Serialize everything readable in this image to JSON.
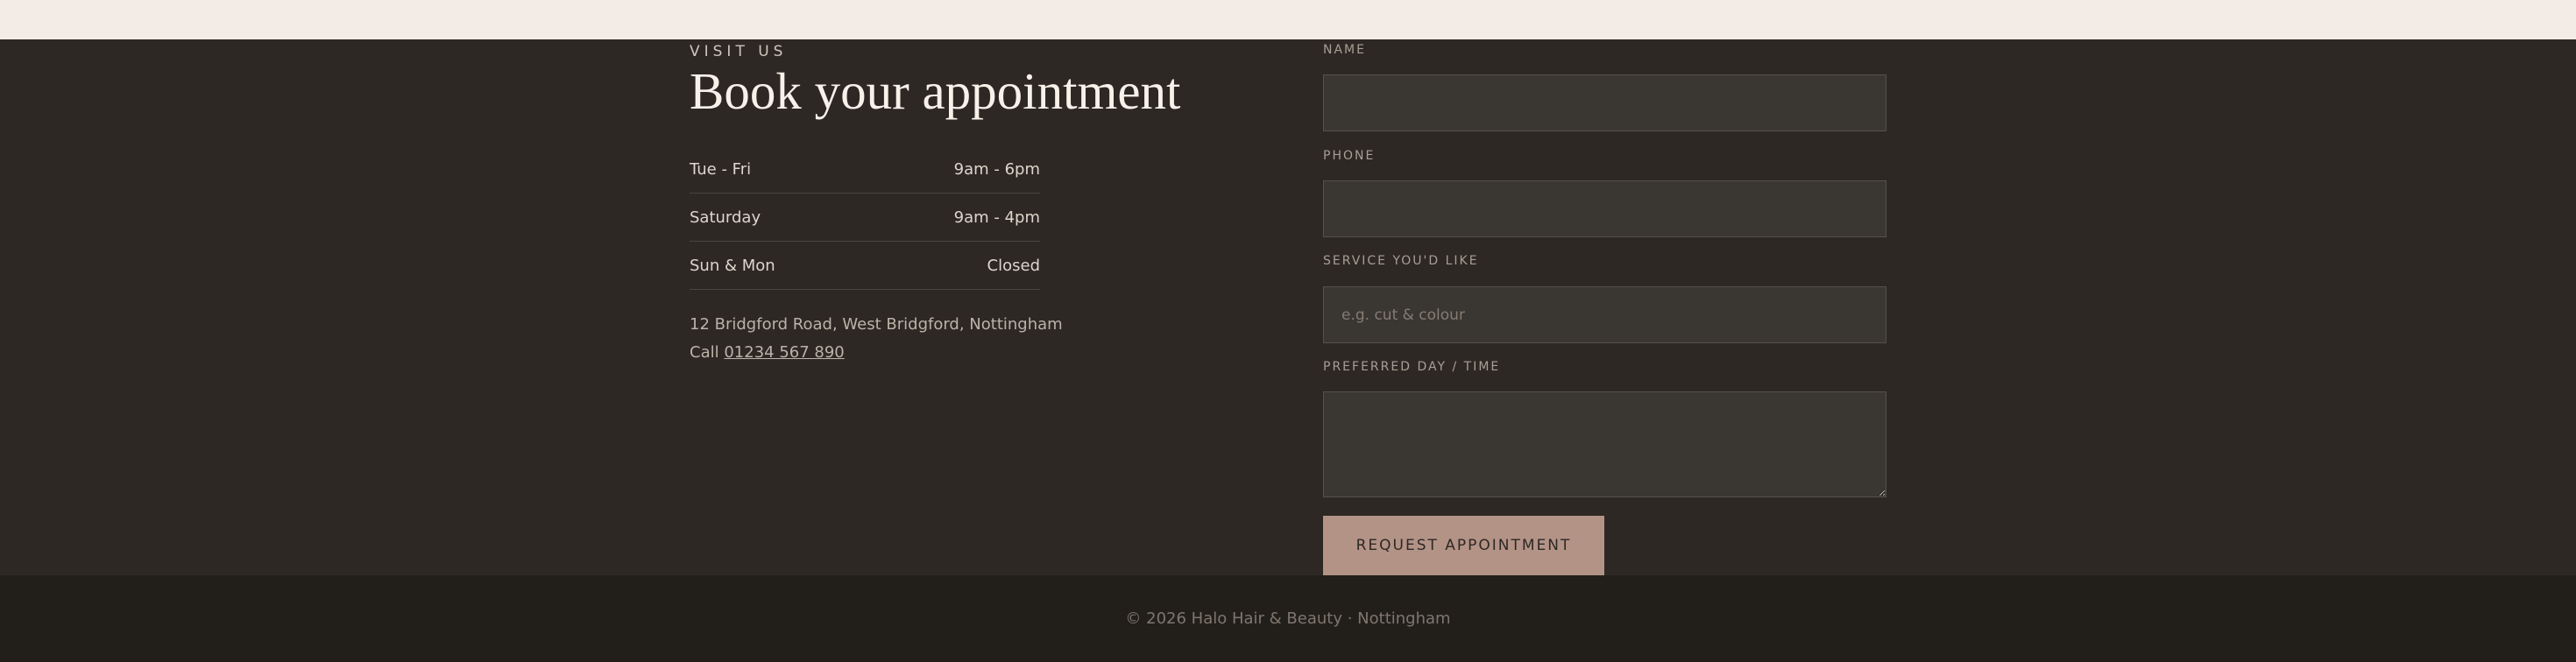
{
  "visit": {
    "eyebrow": "VISIT US",
    "title": "Book your appointment",
    "hours": [
      {
        "day": "Tue - Fri",
        "time": "9am - 6pm"
      },
      {
        "day": "Saturday",
        "time": "9am - 4pm"
      },
      {
        "day": "Sun & Mon",
        "time": "Closed"
      }
    ],
    "address": "12 Bridgford Road, West Bridgford, Nottingham",
    "call_prefix": "Call",
    "phone": "01234 567 890"
  },
  "form": {
    "name_label": "NAME",
    "name_value": "",
    "phone_label": "PHONE",
    "phone_value": "",
    "service_label": "SERVICE YOU'D LIKE",
    "service_placeholder": "e.g. cut & colour",
    "service_value": "",
    "time_label": "PREFERRED DAY / TIME",
    "time_value": "",
    "submit_label": "REQUEST APPOINTMENT"
  },
  "footer": {
    "text": "© 2026 Halo Hair & Beauty · Nottingham"
  },
  "colors": {
    "background": "#2d2824",
    "top_band": "#f3ece6",
    "footer": "#221f1b",
    "accent": "#b49387"
  }
}
